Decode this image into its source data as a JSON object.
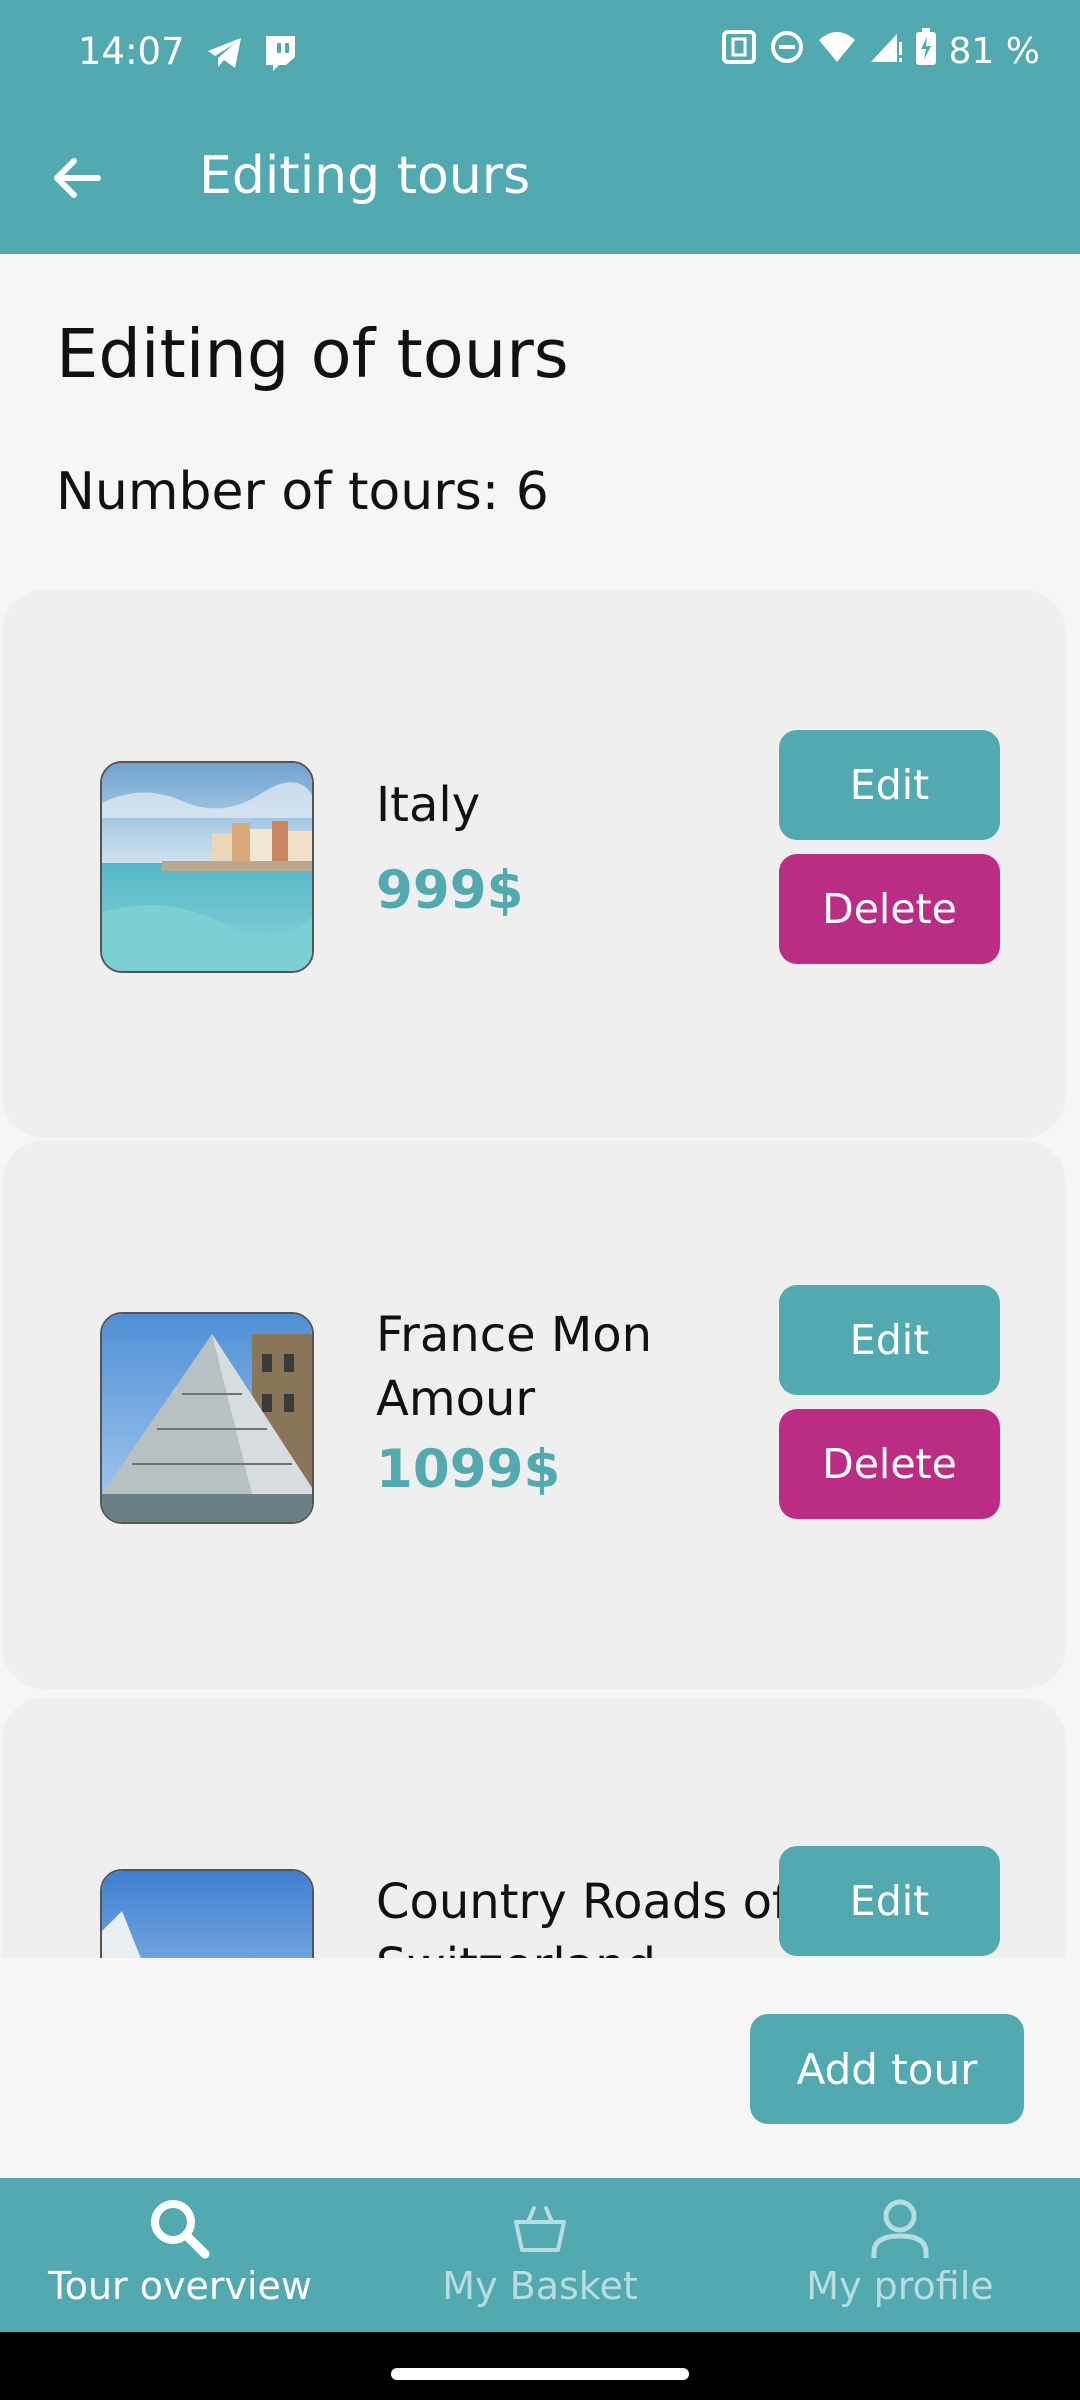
{
  "status_bar": {
    "time": "14:07",
    "battery": "81 %"
  },
  "app_bar": {
    "title": "Editing tours"
  },
  "page": {
    "heading": "Editing of tours",
    "count_label": "Number of tours: 6"
  },
  "tours": [
    {
      "name": "Italy",
      "price": "999$",
      "edit_label": "Edit",
      "delete_label": "Delete"
    },
    {
      "name": "France Mon Amour",
      "price": "1099$",
      "edit_label": "Edit",
      "delete_label": "Delete"
    },
    {
      "name": "Country Roads of Switzerland",
      "edit_label": "Edit"
    }
  ],
  "actions": {
    "add_tour": "Add tour"
  },
  "bottom_nav": [
    {
      "label": "Tour overview",
      "icon": "search-icon",
      "active": true
    },
    {
      "label": "My Basket",
      "icon": "basket-icon",
      "active": false
    },
    {
      "label": "My profile",
      "icon": "profile-icon",
      "active": false
    }
  ],
  "colors": {
    "primary": "#52a9b0",
    "delete": "#bb2d84",
    "background": "#f6f6f6",
    "card": "#efefef"
  }
}
